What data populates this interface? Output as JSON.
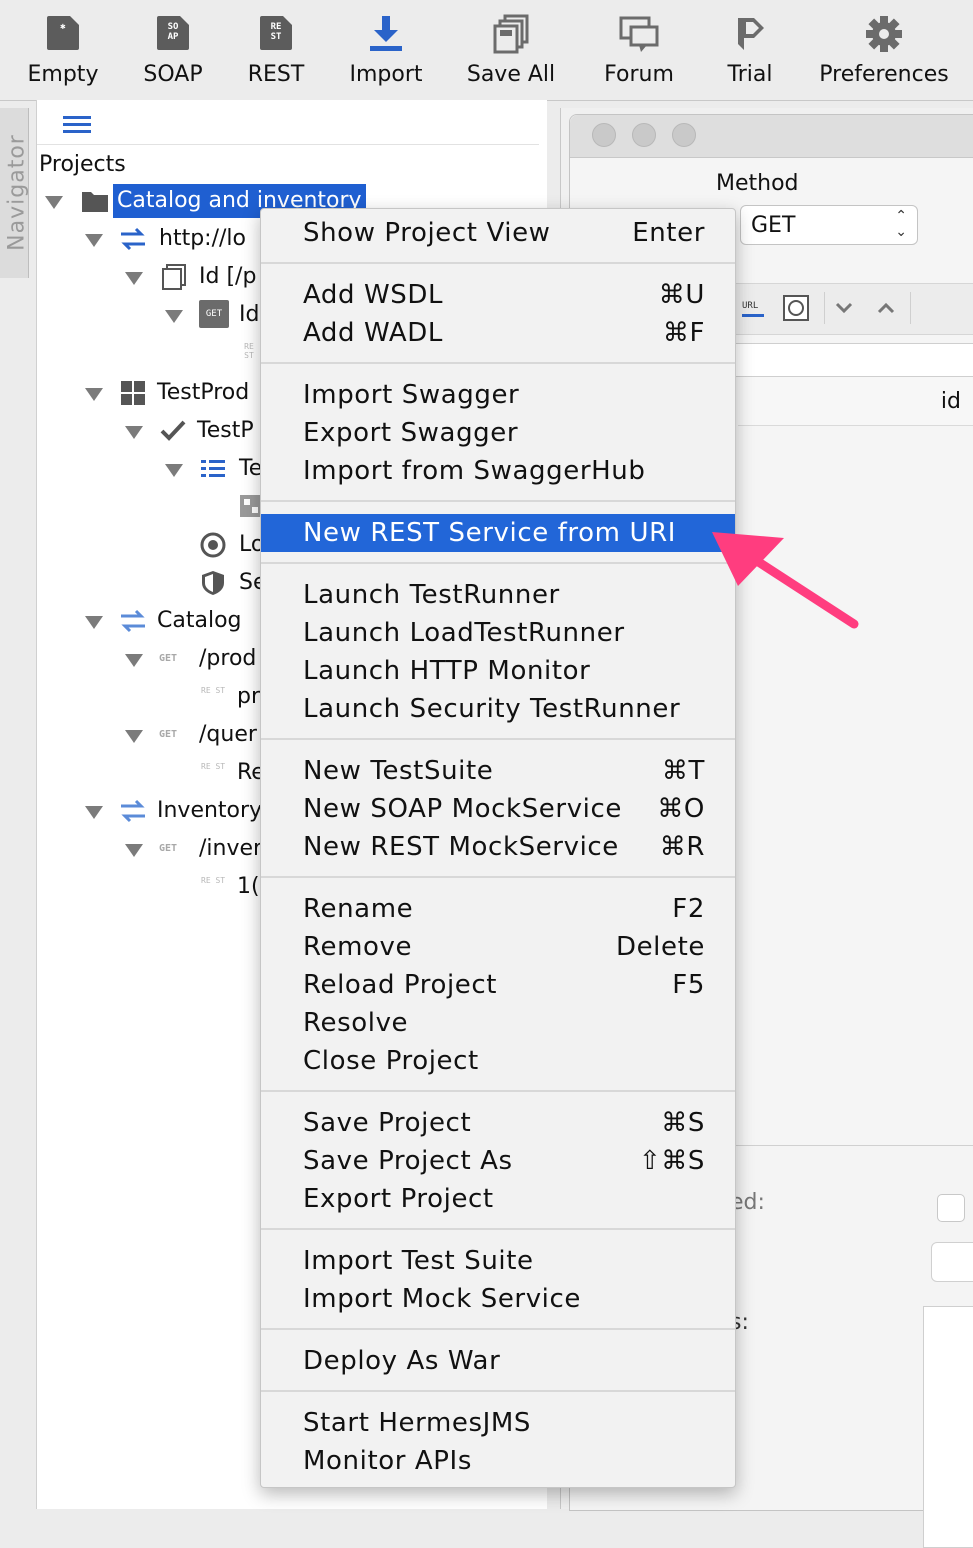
{
  "toolbar": {
    "buttons": [
      {
        "label": "Empty",
        "icon": "empty-project-icon"
      },
      {
        "label": "SOAP",
        "icon": "soap-project-icon",
        "badge": "SO\nAP"
      },
      {
        "label": "REST",
        "icon": "rest-project-icon",
        "badge": "RE\nST"
      },
      {
        "label": "Import",
        "icon": "import-icon"
      },
      {
        "label": "Save All",
        "icon": "save-all-icon"
      },
      {
        "label": "Forum",
        "icon": "forum-icon"
      },
      {
        "label": "Trial",
        "icon": "trial-icon"
      },
      {
        "label": "Preferences",
        "icon": "gear-icon"
      }
    ]
  },
  "navigator": {
    "tab_label": "Navigator",
    "header": "Projects",
    "tree": {
      "project": "Catalog and inventory",
      "service1": "http://lo",
      "resource1": "Id [/p",
      "method1_tag": "GET",
      "method1": "Id",
      "req1_tag": "RE ST",
      "testprod": "TestProd",
      "testp": "TestP",
      "te": "Te",
      "lo": "Lo",
      "se": "Se",
      "catalog": "Catalog",
      "get_prod_tag": "GET",
      "prod": "/prod",
      "pr_tag": "RE ST",
      "pr": "pr",
      "get_quer_tag": "GET",
      "quer": "/quer",
      "re_tag": "RE ST",
      "re": "Re",
      "inventory": "Inventory",
      "get_inver_tag": "GET",
      "inver": "/inver",
      "ten_tag": "RE ST",
      "ten": "1("
    }
  },
  "editor": {
    "method_label": "Method",
    "method_value": "GET",
    "param_column": "id",
    "lower_label1": "ed:",
    "lower_label2": "s:"
  },
  "context_menu": {
    "sections": [
      [
        {
          "label": "Show Project View",
          "shortcut": "Enter"
        }
      ],
      [
        {
          "label": "Add WSDL",
          "shortcut": "⌘U"
        },
        {
          "label": "Add WADL",
          "shortcut": "⌘F"
        }
      ],
      [
        {
          "label": "Import Swagger",
          "shortcut": ""
        },
        {
          "label": "Export Swagger",
          "shortcut": ""
        },
        {
          "label": "Import from SwaggerHub",
          "shortcut": ""
        }
      ],
      [
        {
          "label": "New REST Service from URI",
          "shortcut": "",
          "highlighted": true
        }
      ],
      [
        {
          "label": "Launch TestRunner",
          "shortcut": ""
        },
        {
          "label": "Launch LoadTestRunner",
          "shortcut": ""
        },
        {
          "label": "Launch HTTP Monitor",
          "shortcut": ""
        },
        {
          "label": "Launch Security TestRunner",
          "shortcut": ""
        }
      ],
      [
        {
          "label": "New TestSuite",
          "shortcut": "⌘T"
        },
        {
          "label": "New SOAP MockService",
          "shortcut": "⌘O"
        },
        {
          "label": "New REST MockService",
          "shortcut": "⌘R"
        }
      ],
      [
        {
          "label": "Rename",
          "shortcut": "F2"
        },
        {
          "label": "Remove",
          "shortcut": "Delete"
        },
        {
          "label": "Reload Project",
          "shortcut": "F5"
        },
        {
          "label": "Resolve",
          "shortcut": ""
        },
        {
          "label": "Close Project",
          "shortcut": ""
        }
      ],
      [
        {
          "label": "Save Project",
          "shortcut": "⌘S"
        },
        {
          "label": "Save Project As",
          "shortcut": "⇧⌘S"
        },
        {
          "label": "Export Project",
          "shortcut": ""
        }
      ],
      [
        {
          "label": "Import Test Suite",
          "shortcut": ""
        },
        {
          "label": "Import Mock Service",
          "shortcut": ""
        }
      ],
      [
        {
          "label": "Deploy As War",
          "shortcut": ""
        }
      ],
      [
        {
          "label": "Start HermesJMS",
          "shortcut": ""
        },
        {
          "label": "Monitor APIs",
          "shortcut": ""
        }
      ]
    ]
  },
  "colors": {
    "selection": "#1f5fd1",
    "menu_highlight": "#2266d8",
    "annotation_arrow": "#ff3d7f"
  }
}
